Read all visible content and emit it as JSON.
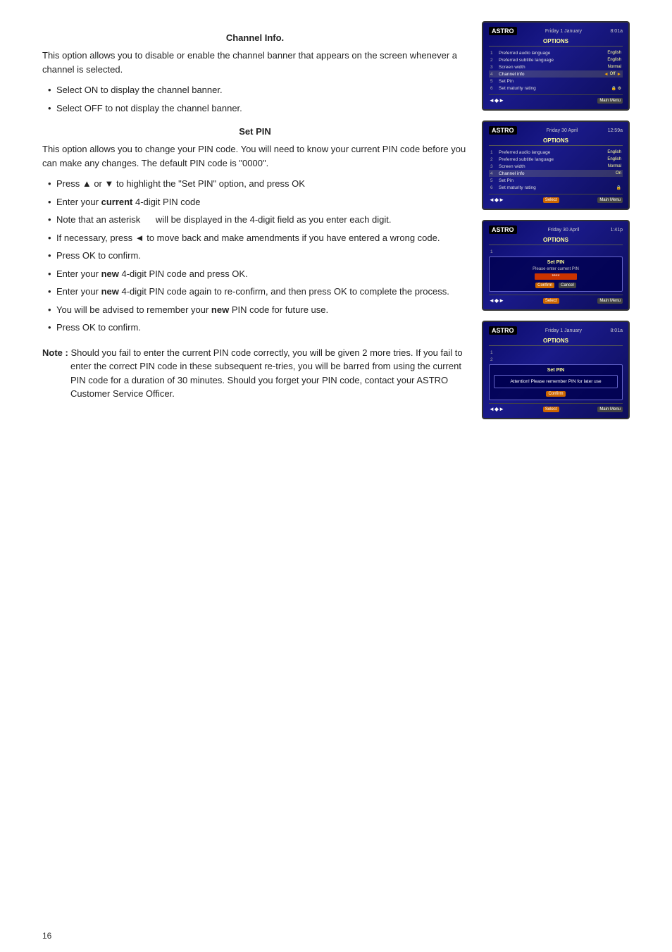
{
  "page": {
    "number": "16"
  },
  "channel_info": {
    "title": "Channel Info.",
    "intro": "This option allows you to disable or enable the channel banner that appears on the screen whenever a channel is selected.",
    "bullets": [
      "Select ON to display the channel banner.",
      "Select OFF to not display the channel banner."
    ]
  },
  "set_pin": {
    "title": "Set PIN",
    "intro": "This option allows you to change your PIN code. You will need to know your current PIN code before you can make any changes.  The default PIN code is \"0000\".",
    "bullets": [
      {
        "text": "Press ▲ or ▼ to highlight the \"Set PIN\" option, and press OK",
        "bold": false
      },
      {
        "text": "Enter your ",
        "bold_word": "current",
        "rest": " 4-digit PIN code"
      },
      {
        "text": "Note that an asterisk     will be displayed in the 4-digit field as you enter each digit.",
        "bold": false
      },
      {
        "text": "If necessary, press ◄ to move back and make amendments if you have entered a wrong code.",
        "bold": false
      },
      {
        "text": "Press OK to confirm.",
        "bold": false
      },
      {
        "text": "Enter your ",
        "bold_word": "new",
        "rest": " 4-digit PIN code and press OK."
      },
      {
        "text": "Enter your ",
        "bold_word": "new",
        "rest": " 4-digit PIN code again to re-confirm, and then press OK to complete the process."
      },
      {
        "text": "You will be advised to remember your ",
        "bold_word": "new",
        "rest": " PIN code for future use."
      },
      {
        "text": "Press OK to confirm.",
        "bold": false
      }
    ],
    "note": "Note :  Should you fail to enter the current PIN code correctly, you will be given 2 more tries.  If you fail to enter the correct PIN code in these subsequent re-tries, you will be barred from using the current PIN code for a duration of 30 minutes.  Should you forget your PIN code, contact your ASTRO Customer Service Officer."
  },
  "screens": {
    "screen1": {
      "date": "Friday 1 January",
      "time": "8:01a",
      "title": "OPTIONS",
      "rows": [
        {
          "num": "1",
          "label": "Preferred audio language",
          "value": "English"
        },
        {
          "num": "2",
          "label": "Preferred subtitle language",
          "value": "English"
        },
        {
          "num": "3",
          "label": "Screen width",
          "value": "Normal"
        },
        {
          "num": "4",
          "label": "Channel info",
          "value": "Off",
          "highlighted": true,
          "arrows": true
        },
        {
          "num": "5",
          "label": "Set Pin",
          "value": ""
        },
        {
          "num": "6",
          "label": "Set maturity rating",
          "value": "🔒⚙"
        }
      ],
      "bottom_left": "◄◆►",
      "bottom_right": "Main Menu"
    },
    "screen2": {
      "date": "Friday 30 April",
      "time": "12:59a",
      "title": "OPTIONS",
      "rows": [
        {
          "num": "1",
          "label": "Preferred audio language",
          "value": "English"
        },
        {
          "num": "2",
          "label": "Preferred subtitle language",
          "value": "English"
        },
        {
          "num": "3",
          "label": "Screen width",
          "value": "Normal"
        },
        {
          "num": "4",
          "label": "Channel info",
          "value": "On",
          "highlighted": true
        },
        {
          "num": "5",
          "label": "Set Pin",
          "value": ""
        },
        {
          "num": "6",
          "label": "Set maturity rating",
          "value": "🔒"
        }
      ],
      "bottom_left": "◄◆►",
      "bottom_right_select": "Select",
      "bottom_right_menu": "Main Menu"
    },
    "screen3": {
      "date": "Friday 30 April",
      "time": "1:41p",
      "title": "OPTIONS",
      "dialog_title": "Set PIN",
      "dialog_prompt": "Please enter current PIN",
      "pin_value": "****",
      "buttons": [
        "Confirm",
        "Cancel"
      ],
      "bottom_left": "◄◆►",
      "bottom_select": "Select",
      "bottom_menu": "Main Menu"
    },
    "screen4": {
      "date": "Friday 1 January",
      "time": "8:01a",
      "title": "OPTIONS",
      "dialog_title": "Set PIN",
      "attention_text": "Attention! Please remember PIN for later use",
      "button": "Confirm",
      "bottom_left": "◄◆►",
      "bottom_select": "Select",
      "bottom_menu": "Main Menu"
    }
  }
}
